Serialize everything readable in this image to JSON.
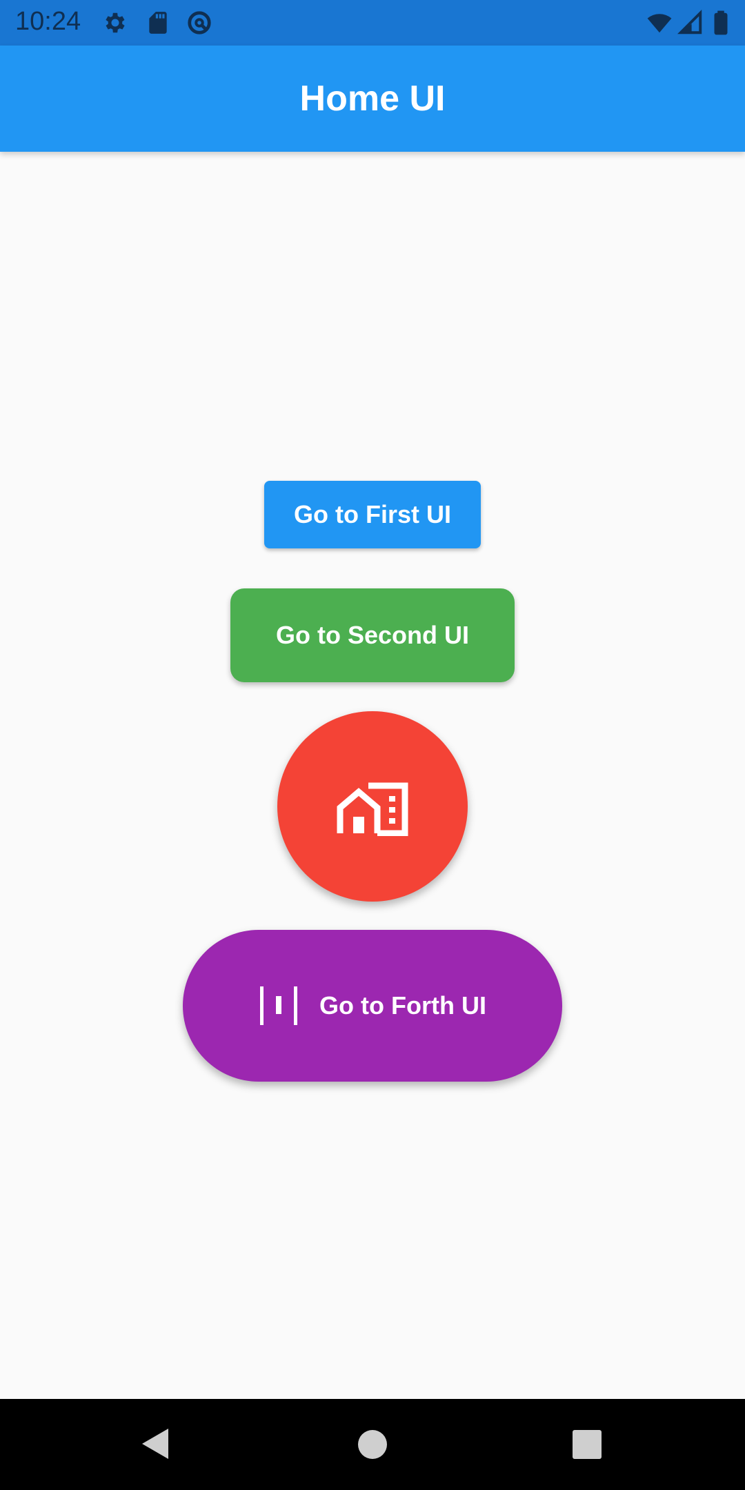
{
  "status_bar": {
    "time": "10:24",
    "left_icons": [
      "gear-icon",
      "sd-card-icon",
      "do-not-disturb-icon"
    ],
    "right_icons": [
      "wifi-icon",
      "signal-icon",
      "battery-icon"
    ],
    "color": "#1976d2"
  },
  "app_bar": {
    "title": "Home UI",
    "color": "#2196f3"
  },
  "buttons": {
    "first": {
      "label": "Go to First UI",
      "color": "#2196f3"
    },
    "second": {
      "label": "Go to Second UI",
      "color": "#4caf50"
    },
    "third": {
      "icon": "home-work-icon",
      "color": "#f44336"
    },
    "forth": {
      "label": "Go to Forth UI",
      "icon": "view-week-icon",
      "color": "#9c27b0"
    }
  },
  "nav_bar": {
    "icons": [
      "back-icon",
      "home-icon",
      "recents-icon"
    ]
  }
}
